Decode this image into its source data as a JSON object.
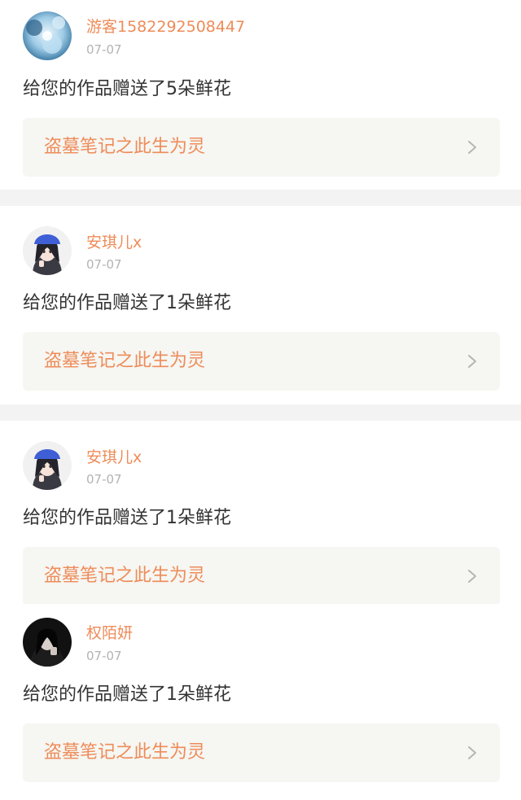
{
  "items": [
    {
      "username": "游客1582292508447",
      "date": "07-07",
      "message": "给您的作品赠送了5朵鲜花",
      "work_title": "盗墓笔记之此生为灵",
      "avatar": "avatar-blue-flower"
    },
    {
      "username": "安琪儿x",
      "date": "07-07",
      "message": "给您的作品赠送了1朵鲜花",
      "work_title": "盗墓笔记之此生为灵",
      "avatar": "avatar-anime-girl-blue-hat"
    },
    {
      "username": "安琪儿x",
      "date": "07-07",
      "message": "给您的作品赠送了1朵鲜花",
      "work_title": "盗墓笔记之此生为灵",
      "avatar": "avatar-anime-girl-blue-hat"
    },
    {
      "username": "权陌妍",
      "date": "07-07",
      "message": "给您的作品赠送了1朵鲜花",
      "work_title": "盗墓笔记之此生为灵",
      "avatar": "avatar-dark-portrait"
    }
  ],
  "colors": {
    "accent": "#ee8c59",
    "date": "#b3b3b3",
    "text": "#333333",
    "link_bg": "#f6f6f2",
    "separator": "#f3f3f3"
  }
}
